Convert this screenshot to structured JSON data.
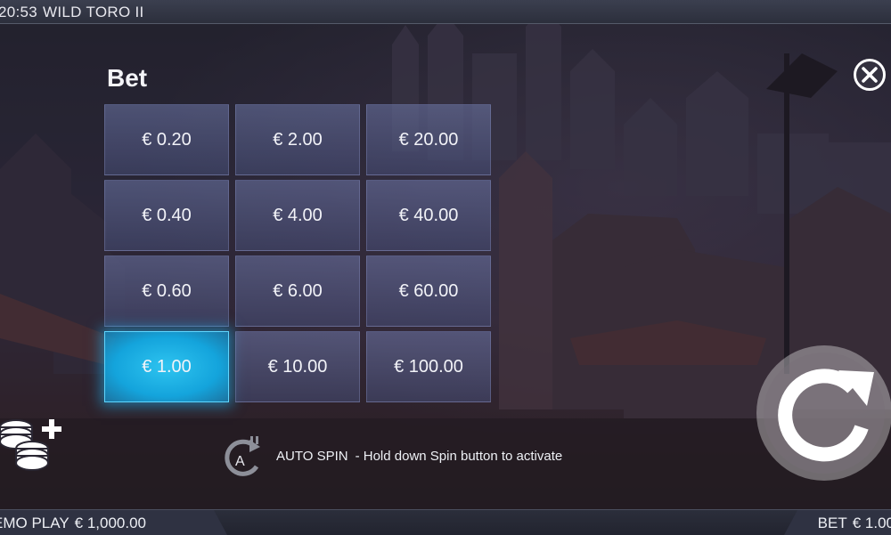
{
  "topbar": {
    "time": "20:53",
    "game_title": "WILD TORO II"
  },
  "bet_panel": {
    "title": "Bet",
    "options": [
      {
        "label": "€ 0.20",
        "selected": false
      },
      {
        "label": "€ 2.00",
        "selected": false
      },
      {
        "label": "€ 20.00",
        "selected": false
      },
      {
        "label": "€ 0.40",
        "selected": false
      },
      {
        "label": "€ 4.00",
        "selected": false
      },
      {
        "label": "€ 40.00",
        "selected": false
      },
      {
        "label": "€ 0.60",
        "selected": false
      },
      {
        "label": "€ 6.00",
        "selected": false
      },
      {
        "label": "€ 60.00",
        "selected": false
      },
      {
        "label": "€ 1.00",
        "selected": true
      },
      {
        "label": "€ 10.00",
        "selected": false
      },
      {
        "label": "€ 100.00",
        "selected": false
      }
    ],
    "selected_color": "#1aa8e0"
  },
  "autospin": {
    "label": "AUTO SPIN",
    "hint": "- Hold down Spin button to activate",
    "icon_letter": "A"
  },
  "bottombar": {
    "mode_label": "EMO PLAY",
    "balance": "€ 1,000.00",
    "bet_label": "BET",
    "bet_value": "€ 1.00"
  },
  "icons": {
    "close": "close-icon",
    "coins": "coins-plus-icon",
    "spin": "spin-icon",
    "autospin": "autospin-icon"
  }
}
